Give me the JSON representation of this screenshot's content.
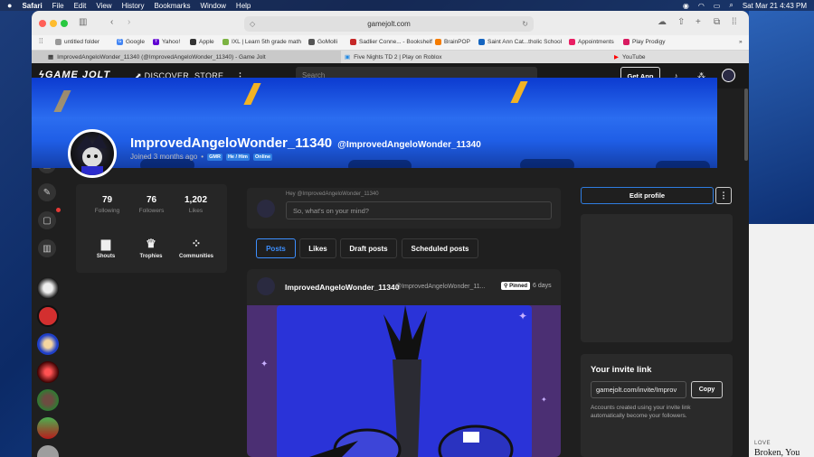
{
  "menubar": {
    "app": "Safari",
    "items": [
      "File",
      "Edit",
      "View",
      "History",
      "Bookmarks",
      "Window",
      "Help"
    ],
    "datetime": "Sat Mar 21  4:43 PM"
  },
  "browser": {
    "url": "gamejolt.com",
    "bookmarks": [
      "untitled folder",
      "Google",
      "Yahoo!",
      "Apple",
      "IXL | Learn 5th grade math",
      "GoMolli",
      "Sadlier Conne... - Bookshelf",
      "BrainPOP",
      "Saint Ann Cat...tholic School",
      "Appointments",
      "Play Prodigy"
    ],
    "tabs": [
      "ImprovedAngeloWonder_11340 (@ImprovedAngeloWonder_11340) - Game Jolt",
      "Five Nights TD 2 | Play on Roblox",
      "YouTube"
    ]
  },
  "site": {
    "logo": "GAME JOLT",
    "nav_discover": "DISCOVER",
    "nav_store": "STORE",
    "search_placeholder": "Search",
    "get_app": "Get App"
  },
  "profile": {
    "name": "ImprovedAngeloWonder_11340",
    "handle": "@ImprovedAngeloWonder_11340",
    "joined": "Joined 3 months ago",
    "badges": [
      "GMR",
      "He / Him",
      "Online"
    ],
    "stats": [
      {
        "value": "79",
        "label": "Following"
      },
      {
        "value": "76",
        "label": "Followers"
      },
      {
        "value": "1,202",
        "label": "Likes"
      }
    ],
    "links": [
      "Shouts",
      "Trophies",
      "Communities"
    ]
  },
  "composer": {
    "greeting": "Hey @ImprovedAngeloWonder_11340",
    "placeholder": "So, what's on your mind?"
  },
  "feed_tabs": [
    "Posts",
    "Likes",
    "Draft posts",
    "Scheduled posts"
  ],
  "post": {
    "author": "ImprovedAngeloWonder_11340",
    "handle": "@ImprovedAngeloWonder_11...",
    "pinned": "Pinned",
    "age": "6 days"
  },
  "sidebar": {
    "edit_profile": "Edit profile",
    "more": "⋮"
  },
  "invite": {
    "title": "Your invite link",
    "link": "gamejolt.com/invite/Improv",
    "copy": "Copy",
    "desc": "Accounts created using your invite link automatically become your followers."
  },
  "desktop": {
    "card_kicker": "LOVE",
    "card_title": "Broken, You"
  },
  "colors": {
    "accent": "#2f7de0",
    "bolt": "#f2b324",
    "banner": "#2b6df0"
  }
}
